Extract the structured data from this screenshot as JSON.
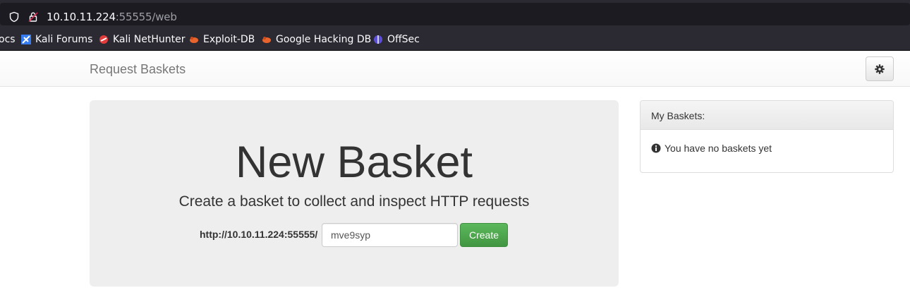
{
  "browser": {
    "url_host": "10.10.11.224",
    "url_path": ":55555/web",
    "bookmarks": [
      {
        "label": "ocs"
      },
      {
        "label": "Kali Forums"
      },
      {
        "label": "Kali NetHunter"
      },
      {
        "label": "Exploit-DB"
      },
      {
        "label": "Google Hacking DB"
      },
      {
        "label": "OffSec"
      }
    ]
  },
  "navbar": {
    "brand": "Request Baskets",
    "settings_icon": "gear-icon"
  },
  "jumbotron": {
    "title": "New Basket",
    "subtitle": "Create a basket to collect and inspect HTTP requests",
    "url_prefix": "http://10.10.11.224:55555/",
    "basket_name_value": "mve9syp",
    "create_label": "Create"
  },
  "panel": {
    "heading": "My Baskets:",
    "empty_message": "You have no baskets yet",
    "info_icon": "info-circle-icon"
  },
  "colors": {
    "create_button": "#5cb85c",
    "jumbotron_bg": "#eeeeee",
    "browser_chrome": "#2b2a33"
  }
}
